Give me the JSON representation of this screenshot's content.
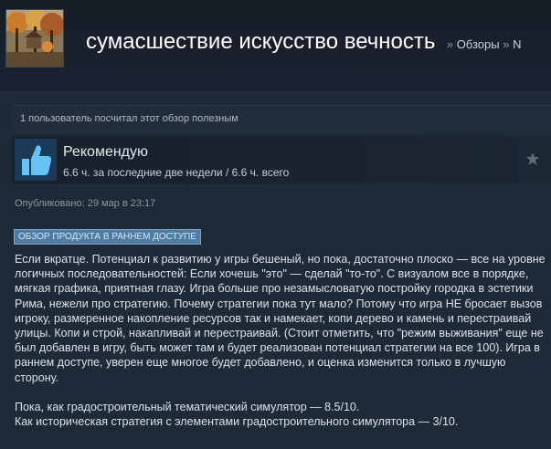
{
  "header": {
    "game_title": "сумасшествие искусство вечность",
    "breadcrumb_sep1": "»",
    "breadcrumb_reviews": "Обзоры",
    "breadcrumb_sep2": "»",
    "breadcrumb_user": "N"
  },
  "helpful": {
    "text": "1 пользователь посчитал этот обзор полезным"
  },
  "recommendation": {
    "title": "Рекомендую",
    "hours": "6.6 ч. за последние две недели / 6.6 ч. всего",
    "icon": "thumbs-up-icon",
    "award_icon": "star-icon"
  },
  "posted": "Опубликовано: 29 мар в 23:17",
  "early_access_badge": "ОБЗОР ПРОДУКТА В РАННЕМ ДОСТУПЕ",
  "review": {
    "paragraph_1": "Если вкратце. Потенциал к развитию у игры бешеный, но пока, достаточно плоско — все на уровне логичных последовательностей: Если хочешь \"это\" — сделай \"то-то\". С визуалом все в порядке, мягкая графика, приятная глазу. Игра больше про незамысловатую постройку городка в эстетики Рима, нежели про стратегию. Почему стратегии пока тут мало? Потому что игра НЕ бросает вызов игроку, размеренное накопление ресурсов так и намекает, копи дерево и камень и перестраивай улицы. Копи и строй, накапливай и перестраивай. (Стоит отметить, что \"режим выживания\" еще не был добавлен в игру, быть может там и будет реализован потенциал стратегии на все 100). Игра в раннем доступе, уверен еще многое будет добавлено, и оценка изменится только в лучшую сторону.",
    "line_simulator": "Пока, как градостроительный тематический симулятор — 8.5/10.",
    "line_strategy": "Как историческая стратегия с элементами градостроительного симулятора — 3/10."
  },
  "colors": {
    "background": "#1b2838",
    "badge": "#4f7ca3",
    "thumb": "#67c1f5"
  }
}
